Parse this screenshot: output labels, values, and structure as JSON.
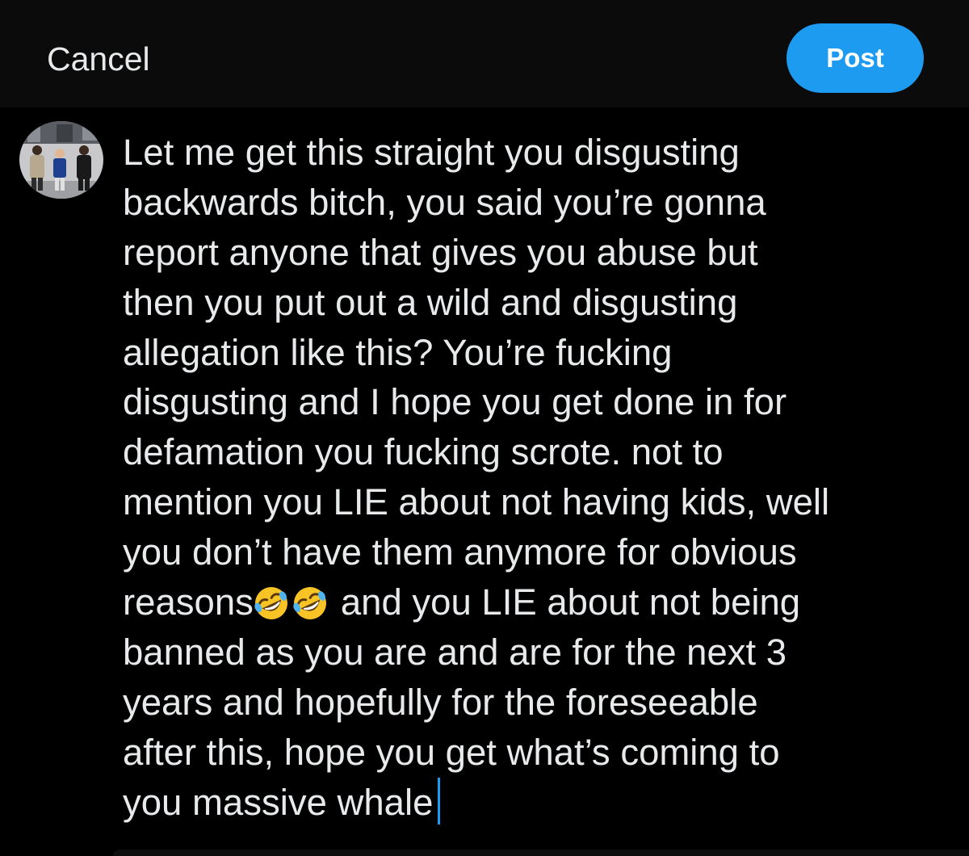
{
  "header": {
    "cancel_label": "Cancel",
    "post_label": "Post",
    "post_color": "#1d9bf0"
  },
  "compose": {
    "lines": [
      "Let me get this straight you disgusting",
      "backwards bitch, you said you’re gonna",
      "report anyone that gives you abuse but",
      "then you put out a wild and disgusting",
      "allegation like this? You’re fucking",
      "disgusting and I hope you get done in for",
      "defamation you fucking scrote. not to",
      "mention you LIE about not having kids, well",
      "you don’t have them anymore for obvious",
      "reasons",
      "and you LIE about not being",
      "banned as you are and are for the next 3",
      "years and hopefully for the foreseeable",
      "after this, hope you get what’s coming to",
      "you massive whale"
    ],
    "emoji_icon": "rolling-on-the-floor-laughing-emoji",
    "emoji_count": 2,
    "caret_color": "#1d9bf0"
  },
  "colors": {
    "background": "#000000",
    "header_background": "#0b0b0b",
    "text": "#e7e9ea"
  }
}
